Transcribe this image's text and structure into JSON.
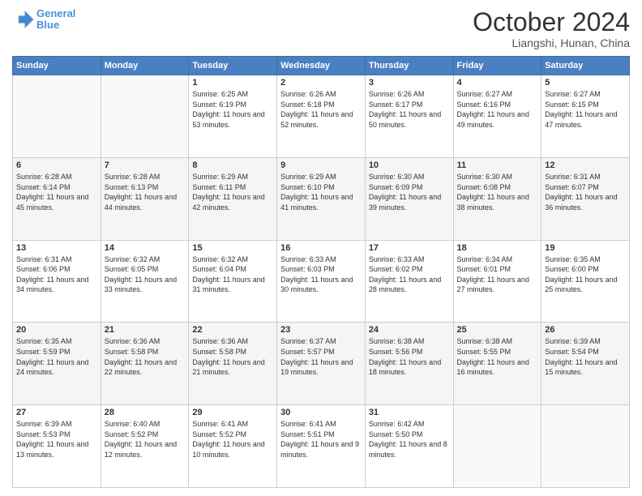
{
  "header": {
    "logo_line1": "General",
    "logo_line2": "Blue",
    "month": "October 2024",
    "location": "Liangshi, Hunan, China"
  },
  "days_of_week": [
    "Sunday",
    "Monday",
    "Tuesday",
    "Wednesday",
    "Thursday",
    "Friday",
    "Saturday"
  ],
  "weeks": [
    [
      {
        "num": "",
        "info": ""
      },
      {
        "num": "",
        "info": ""
      },
      {
        "num": "1",
        "info": "Sunrise: 6:25 AM\nSunset: 6:19 PM\nDaylight: 11 hours\nand 53 minutes."
      },
      {
        "num": "2",
        "info": "Sunrise: 6:26 AM\nSunset: 6:18 PM\nDaylight: 11 hours\nand 52 minutes."
      },
      {
        "num": "3",
        "info": "Sunrise: 6:26 AM\nSunset: 6:17 PM\nDaylight: 11 hours\nand 50 minutes."
      },
      {
        "num": "4",
        "info": "Sunrise: 6:27 AM\nSunset: 6:16 PM\nDaylight: 11 hours\nand 49 minutes."
      },
      {
        "num": "5",
        "info": "Sunrise: 6:27 AM\nSunset: 6:15 PM\nDaylight: 11 hours\nand 47 minutes."
      }
    ],
    [
      {
        "num": "6",
        "info": "Sunrise: 6:28 AM\nSunset: 6:14 PM\nDaylight: 11 hours\nand 45 minutes."
      },
      {
        "num": "7",
        "info": "Sunrise: 6:28 AM\nSunset: 6:13 PM\nDaylight: 11 hours\nand 44 minutes."
      },
      {
        "num": "8",
        "info": "Sunrise: 6:29 AM\nSunset: 6:11 PM\nDaylight: 11 hours\nand 42 minutes."
      },
      {
        "num": "9",
        "info": "Sunrise: 6:29 AM\nSunset: 6:10 PM\nDaylight: 11 hours\nand 41 minutes."
      },
      {
        "num": "10",
        "info": "Sunrise: 6:30 AM\nSunset: 6:09 PM\nDaylight: 11 hours\nand 39 minutes."
      },
      {
        "num": "11",
        "info": "Sunrise: 6:30 AM\nSunset: 6:08 PM\nDaylight: 11 hours\nand 38 minutes."
      },
      {
        "num": "12",
        "info": "Sunrise: 6:31 AM\nSunset: 6:07 PM\nDaylight: 11 hours\nand 36 minutes."
      }
    ],
    [
      {
        "num": "13",
        "info": "Sunrise: 6:31 AM\nSunset: 6:06 PM\nDaylight: 11 hours\nand 34 minutes."
      },
      {
        "num": "14",
        "info": "Sunrise: 6:32 AM\nSunset: 6:05 PM\nDaylight: 11 hours\nand 33 minutes."
      },
      {
        "num": "15",
        "info": "Sunrise: 6:32 AM\nSunset: 6:04 PM\nDaylight: 11 hours\nand 31 minutes."
      },
      {
        "num": "16",
        "info": "Sunrise: 6:33 AM\nSunset: 6:03 PM\nDaylight: 11 hours\nand 30 minutes."
      },
      {
        "num": "17",
        "info": "Sunrise: 6:33 AM\nSunset: 6:02 PM\nDaylight: 11 hours\nand 28 minutes."
      },
      {
        "num": "18",
        "info": "Sunrise: 6:34 AM\nSunset: 6:01 PM\nDaylight: 11 hours\nand 27 minutes."
      },
      {
        "num": "19",
        "info": "Sunrise: 6:35 AM\nSunset: 6:00 PM\nDaylight: 11 hours\nand 25 minutes."
      }
    ],
    [
      {
        "num": "20",
        "info": "Sunrise: 6:35 AM\nSunset: 5:59 PM\nDaylight: 11 hours\nand 24 minutes."
      },
      {
        "num": "21",
        "info": "Sunrise: 6:36 AM\nSunset: 5:58 PM\nDaylight: 11 hours\nand 22 minutes."
      },
      {
        "num": "22",
        "info": "Sunrise: 6:36 AM\nSunset: 5:58 PM\nDaylight: 11 hours\nand 21 minutes."
      },
      {
        "num": "23",
        "info": "Sunrise: 6:37 AM\nSunset: 5:57 PM\nDaylight: 11 hours\nand 19 minutes."
      },
      {
        "num": "24",
        "info": "Sunrise: 6:38 AM\nSunset: 5:56 PM\nDaylight: 11 hours\nand 18 minutes."
      },
      {
        "num": "25",
        "info": "Sunrise: 6:38 AM\nSunset: 5:55 PM\nDaylight: 11 hours\nand 16 minutes."
      },
      {
        "num": "26",
        "info": "Sunrise: 6:39 AM\nSunset: 5:54 PM\nDaylight: 11 hours\nand 15 minutes."
      }
    ],
    [
      {
        "num": "27",
        "info": "Sunrise: 6:39 AM\nSunset: 5:53 PM\nDaylight: 11 hours\nand 13 minutes."
      },
      {
        "num": "28",
        "info": "Sunrise: 6:40 AM\nSunset: 5:52 PM\nDaylight: 11 hours\nand 12 minutes."
      },
      {
        "num": "29",
        "info": "Sunrise: 6:41 AM\nSunset: 5:52 PM\nDaylight: 11 hours\nand 10 minutes."
      },
      {
        "num": "30",
        "info": "Sunrise: 6:41 AM\nSunset: 5:51 PM\nDaylight: 11 hours\nand 9 minutes."
      },
      {
        "num": "31",
        "info": "Sunrise: 6:42 AM\nSunset: 5:50 PM\nDaylight: 11 hours\nand 8 minutes."
      },
      {
        "num": "",
        "info": ""
      },
      {
        "num": "",
        "info": ""
      }
    ]
  ]
}
